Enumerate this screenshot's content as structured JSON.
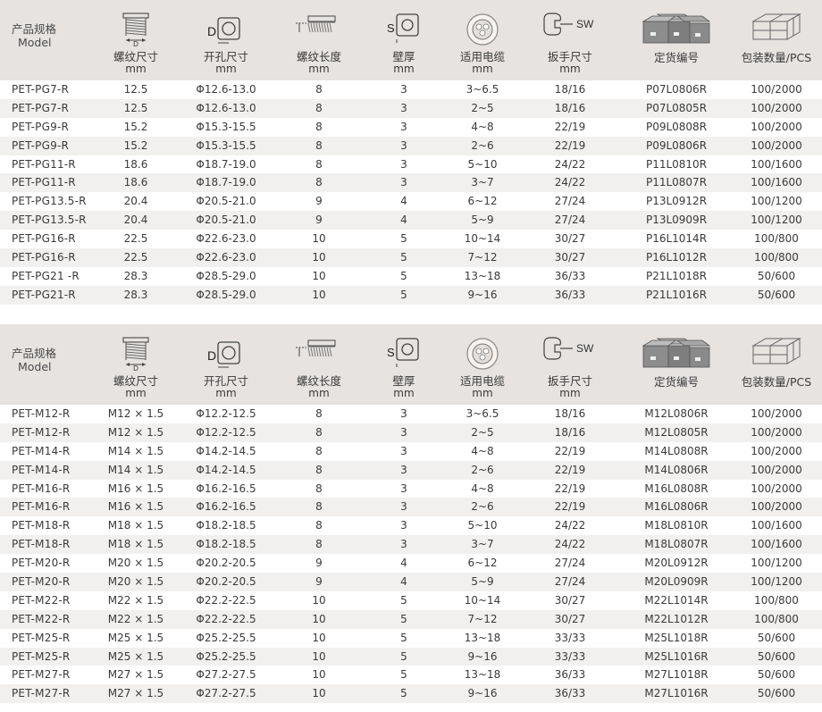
{
  "header": {
    "model_label_cn": "产品规格",
    "model_label_en": "Model",
    "columns": [
      {
        "label": "螺纹尺寸",
        "unit": "mm",
        "icon": "thread-size-icon",
        "icon_text": "D"
      },
      {
        "label": "开孔尺寸",
        "unit": "mm",
        "icon": "hole-size-icon",
        "icon_text": "D"
      },
      {
        "label": "螺纹长度",
        "unit": "mm",
        "icon": "thread-length-icon",
        "icon_text": ""
      },
      {
        "label": "壁厚",
        "unit": "mm",
        "icon": "wall-thickness-icon",
        "icon_text": "S"
      },
      {
        "label": "适用电缆",
        "unit": "mm",
        "icon": "cable-icon",
        "icon_text": ""
      },
      {
        "label": "扳手尺寸",
        "unit": "mm",
        "icon": "wrench-icon",
        "icon_text": "SW"
      },
      {
        "label": "定货编号",
        "unit": "",
        "icon": "boxes-icon",
        "icon_text": ""
      },
      {
        "label": "包装数量/PCS",
        "unit": "",
        "icon": "package-icon",
        "icon_text": ""
      }
    ]
  },
  "pg_rows": [
    [
      "PET-PG7-R",
      "12.5",
      "Φ12.6-13.0",
      "8",
      "3",
      "3~6.5",
      "18/16",
      "P07L0806R",
      "100/2000"
    ],
    [
      "PET-PG7-R",
      "12.5",
      "Φ12.6-13.0",
      "8",
      "3",
      "2~5",
      "18/16",
      "P07L0805R",
      "100/2000"
    ],
    [
      "PET-PG9-R",
      "15.2",
      "Φ15.3-15.5",
      "8",
      "3",
      "4~8",
      "22/19",
      "P09L0808R",
      "100/2000"
    ],
    [
      "PET-PG9-R",
      "15.2",
      "Φ15.3-15.5",
      "8",
      "3",
      "2~6",
      "22/19",
      "P09L0806R",
      "100/2000"
    ],
    [
      "PET-PG11-R",
      "18.6",
      "Φ18.7-19.0",
      "8",
      "3",
      "5~10",
      "24/22",
      "P11L0810R",
      "100/1600"
    ],
    [
      "PET-PG11-R",
      "18.6",
      "Φ18.7-19.0",
      "8",
      "3",
      "3~7",
      "24/22",
      "P11L0807R",
      "100/1600"
    ],
    [
      "PET-PG13.5-R",
      "20.4",
      "Φ20.5-21.0",
      "9",
      "4",
      "6~12",
      "27/24",
      "P13L0912R",
      "100/1200"
    ],
    [
      "PET-PG13.5-R",
      "20.4",
      "Φ20.5-21.0",
      "9",
      "4",
      "5~9",
      "27/24",
      "P13L0909R",
      "100/1200"
    ],
    [
      "PET-PG16-R",
      "22.5",
      "Φ22.6-23.0",
      "10",
      "5",
      "10~14",
      "30/27",
      "P16L1014R",
      "100/800"
    ],
    [
      "PET-PG16-R",
      "22.5",
      "Φ22.6-23.0",
      "10",
      "5",
      "7~12",
      "30/27",
      "P16L1012R",
      "100/800"
    ],
    [
      "PET-PG21 -R",
      "28.3",
      "Φ28.5-29.0",
      "10",
      "5",
      "13~18",
      "36/33",
      "P21L1018R",
      "50/600"
    ],
    [
      "PET-PG21-R",
      "28.3",
      "Φ28.5-29.0",
      "10",
      "5",
      "9~16",
      "36/33",
      "P21L1016R",
      "50/600"
    ]
  ],
  "m_rows": [
    [
      "PET-M12-R",
      "M12 × 1.5",
      "Φ12.2-12.5",
      "8",
      "3",
      "3~6.5",
      "18/16",
      "M12L0806R",
      "100/2000"
    ],
    [
      "PET-M12-R",
      "M12 × 1.5",
      "Φ12.2-12.5",
      "8",
      "3",
      "2~5",
      "18/16",
      "M12L0805R",
      "100/2000"
    ],
    [
      "PET-M14-R",
      "M14 × 1.5",
      "Φ14.2-14.5",
      "8",
      "3",
      "4~8",
      "22/19",
      "M14L0808R",
      "100/2000"
    ],
    [
      "PET-M14-R",
      "M14 × 1.5",
      "Φ14.2-14.5",
      "8",
      "3",
      "2~6",
      "22/19",
      "M14L0806R",
      "100/2000"
    ],
    [
      "PET-M16-R",
      "M16 × 1.5",
      "Φ16.2-16.5",
      "8",
      "3",
      "4~8",
      "22/19",
      "M16L0808R",
      "100/2000"
    ],
    [
      "PET-M16-R",
      "M16 × 1.5",
      "Φ16.2-16.5",
      "8",
      "3",
      "2~6",
      "22/19",
      "M16L0806R",
      "100/2000"
    ],
    [
      "PET-M18-R",
      "M18 × 1.5",
      "Φ18.2-18.5",
      "8",
      "3",
      "5~10",
      "24/22",
      "M18L0810R",
      "100/1600"
    ],
    [
      "PET-M18-R",
      "M18 × 1.5",
      "Φ18.2-18.5",
      "8",
      "3",
      "3~7",
      "24/22",
      "M18L0807R",
      "100/1600"
    ],
    [
      "PET-M20-R",
      "M20 × 1.5",
      "Φ20.2-20.5",
      "9",
      "4",
      "6~12",
      "27/24",
      "M20L0912R",
      "100/1200"
    ],
    [
      "PET-M20-R",
      "M20 × 1.5",
      "Φ20.2-20.5",
      "9",
      "4",
      "5~9",
      "27/24",
      "M20L0909R",
      "100/1200"
    ],
    [
      "PET-M22-R",
      "M22 × 1.5",
      "Φ22.2-22.5",
      "10",
      "5",
      "10~14",
      "30/27",
      "M22L1014R",
      "100/800"
    ],
    [
      "PET-M22-R",
      "M22 × 1.5",
      "Φ22.2-22.5",
      "10",
      "5",
      "7~12",
      "30/27",
      "M22L1012R",
      "100/800"
    ],
    [
      "PET-M25-R",
      "M25 × 1.5",
      "Φ25.2-25.5",
      "10",
      "5",
      "13~18",
      "33/33",
      "M25L1018R",
      "50/600"
    ],
    [
      "PET-M25-R",
      "M25 × 1.5",
      "Φ25.2-25.5",
      "10",
      "5",
      "9~16",
      "33/33",
      "M25L1016R",
      "50/600"
    ],
    [
      "PET-M27-R",
      "M27 × 1.5",
      "Φ27.2-27.5",
      "10",
      "5",
      "13~18",
      "36/33",
      "M27L1018R",
      "50/600"
    ],
    [
      "PET-M27-R",
      "M27 × 1.5",
      "Φ27.2-27.5",
      "10",
      "5",
      "9~16",
      "36/33",
      "M27L1016R",
      "50/600"
    ]
  ],
  "colors": {
    "header_bg": "#e6e3e1",
    "stripe_bg": "#f1f0ef",
    "text": "#3a3a3a"
  }
}
